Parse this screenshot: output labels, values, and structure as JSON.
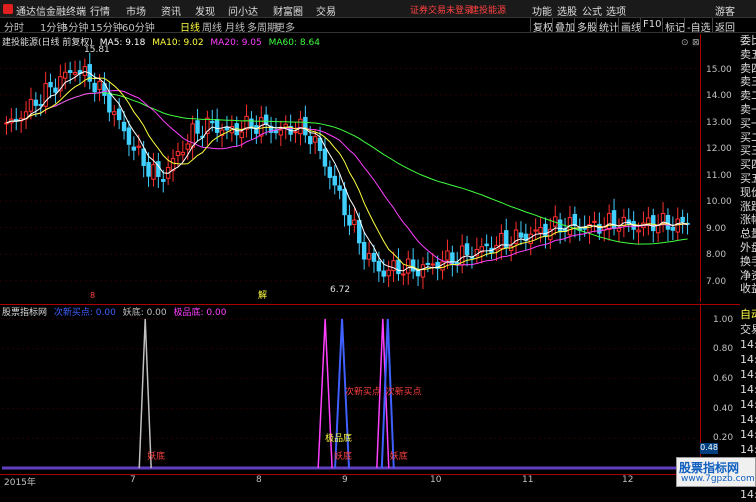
{
  "topbar": {
    "app_title": "通达信金融终端",
    "menus": [
      "行情",
      "市场",
      "资讯",
      "发现",
      "问小达",
      "财富圈",
      "交易"
    ],
    "warn": "证券交易未登录",
    "warn2": "建投能源",
    "right_menus": [
      "功能",
      "选股",
      "公式",
      "选项",
      "游客"
    ]
  },
  "toolbar": {
    "periods": [
      "分时",
      "1分钟",
      "5分钟",
      "15分钟",
      "60分钟",
      "日线",
      "周线",
      "月线",
      "多周期",
      "更多"
    ],
    "active": "日线",
    "right_buttons": [
      "复权",
      "叠加",
      "多股",
      "统计",
      "画线",
      "F10",
      "标记",
      "-自选",
      "返回"
    ]
  },
  "chart": {
    "name": "建投能源(日线 前复权)",
    "ma": [
      {
        "label": "MA5: 9.18",
        "color": "#ffffff"
      },
      {
        "label": "MA10: 9.02",
        "color": "#ffff40"
      },
      {
        "label": "MA20: 9.05",
        "color": "#ff40ff"
      },
      {
        "label": "MA60: 8.64",
        "color": "#40ff40"
      }
    ],
    "y_ticks": [
      "15.00",
      "14.00",
      "13.00",
      "12.00",
      "11.00",
      "10.00",
      "9.00",
      "8.00",
      "7.00"
    ],
    "high_label": "15.81",
    "low_label": "6.72",
    "marker": "解"
  },
  "indicator": {
    "name": "股票指标网",
    "vals": [
      {
        "label": "次新买点: 0.00",
        "color": "#4060ff"
      },
      {
        "label": "妖底: 0.00",
        "color": "#c0c0c0"
      },
      {
        "label": "极品底: 0.00",
        "color": "#ff40ff"
      }
    ],
    "y_ticks": [
      "1.00",
      "0.80",
      "0.60",
      "0.40",
      "0.20"
    ],
    "current": "0.48",
    "ann_yaodi": "妖底",
    "ann_cixin": "次新买点",
    "ann_jipin": "极品底"
  },
  "xaxis": [
    "2015年",
    "7",
    "8",
    "9",
    "10",
    "11",
    "12"
  ],
  "right_panel": [
    "委比",
    "卖五",
    "卖四",
    "卖三",
    "卖二",
    "卖一",
    "买一",
    "买二",
    "买三",
    "买四",
    "买五",
    "现价",
    "涨跌",
    "涨幅",
    "总量",
    "外盘",
    "换手",
    "净资",
    "收益"
  ],
  "right_panel2": [
    "自动",
    "交易",
    "14:56",
    "14:56",
    "14:56",
    "14:56",
    "14:56",
    "14:56",
    "14:56",
    "14:56",
    "14:56",
    "14:56",
    "14:56"
  ],
  "watermark": {
    "line1": "股票指标网",
    "line2": "www.7gpzb.com"
  },
  "chart_data": {
    "type": "candlestick",
    "title": "建投能源(日线 前复权)",
    "x": [
      "2015-06",
      "2015-07",
      "2015-08",
      "2015-09",
      "2015-10",
      "2015-11",
      "2015-12"
    ],
    "ylim": [
      6.5,
      16
    ],
    "close": [
      12.8,
      13.3,
      13.9,
      14.5,
      15.0,
      14.6,
      13.7,
      12.5,
      11.5,
      10.8,
      11.7,
      12.6,
      12.9,
      12.6,
      12.8,
      12.9,
      12.6,
      12.8,
      12.4,
      11.0,
      9.5,
      8.1,
      7.3,
      7.5,
      7.4,
      7.6,
      7.8,
      8.0,
      8.2,
      8.4,
      8.6,
      8.8,
      9.0,
      9.1,
      9.0,
      9.1,
      9.2,
      9.0,
      9.2,
      9.1,
      9.18
    ]
  }
}
